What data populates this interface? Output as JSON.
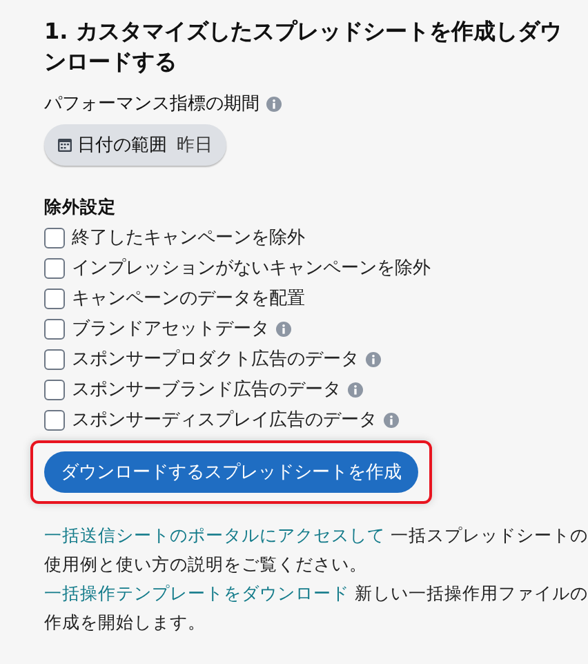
{
  "title": "1. カスタマイズしたスプレッドシートを作成しダウンロードする",
  "period": {
    "label": "パフォーマンス指標の期間",
    "info": true,
    "chip": {
      "label": "日付の範囲",
      "value": "昨日"
    }
  },
  "exclusions": {
    "heading": "除外設定",
    "options": [
      {
        "label": "終了したキャンペーンを除外",
        "checked": false,
        "info": false
      },
      {
        "label": "インプレッションがないキャンペーンを除外",
        "checked": false,
        "info": false
      },
      {
        "label": "キャンペーンのデータを配置",
        "checked": false,
        "info": false
      },
      {
        "label": "ブランドアセットデータ",
        "checked": false,
        "info": true
      },
      {
        "label": "スポンサープロダクト広告のデータ",
        "checked": false,
        "info": true
      },
      {
        "label": "スポンサーブランド広告のデータ",
        "checked": false,
        "info": true
      },
      {
        "label": "スポンサーディスプレイ広告のデータ",
        "checked": false,
        "info": true
      }
    ]
  },
  "create_button": {
    "label": "ダウンロードするスプレッドシートを作成",
    "highlighted": true
  },
  "help": [
    {
      "kind": "link",
      "text": "一括送信シートのポータルにアクセスして"
    },
    {
      "kind": "text",
      "text": " 一括スプレッドシートの使用例と使い方の説明をご覧ください。 "
    },
    {
      "kind": "link",
      "text": "一括操作テンプレートをダウンロード"
    },
    {
      "kind": "text",
      "text": " 新しい一括操作用ファイルの作成を開始します。"
    }
  ]
}
